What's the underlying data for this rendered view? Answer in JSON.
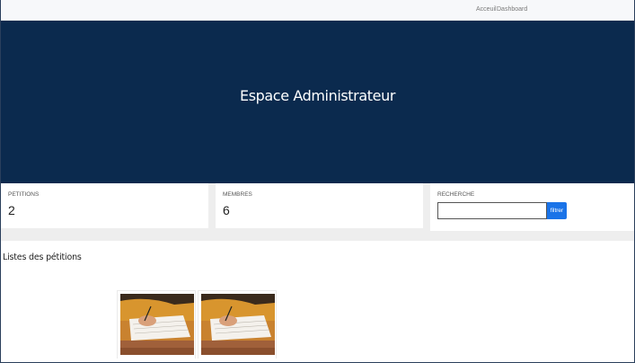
{
  "nav": {
    "links": [
      {
        "label": "Acceuil"
      },
      {
        "label": "Dashboard"
      }
    ]
  },
  "hero": {
    "title": "Espace Administrateur",
    "background": "#0b2a4e"
  },
  "stats": {
    "petitions": {
      "label": "PETITIONS",
      "value": "2"
    },
    "membres": {
      "label": "MEMBRES",
      "value": "6"
    },
    "recherche": {
      "label": "RECHERCHE",
      "input_value": "",
      "placeholder": "",
      "button_label": "filtrer",
      "button_color": "#1a73e8"
    }
  },
  "list": {
    "title": "Listes des pétitions",
    "items": [
      {
        "image": "writing-hand-photo"
      },
      {
        "image": "writing-hand-photo"
      }
    ]
  }
}
